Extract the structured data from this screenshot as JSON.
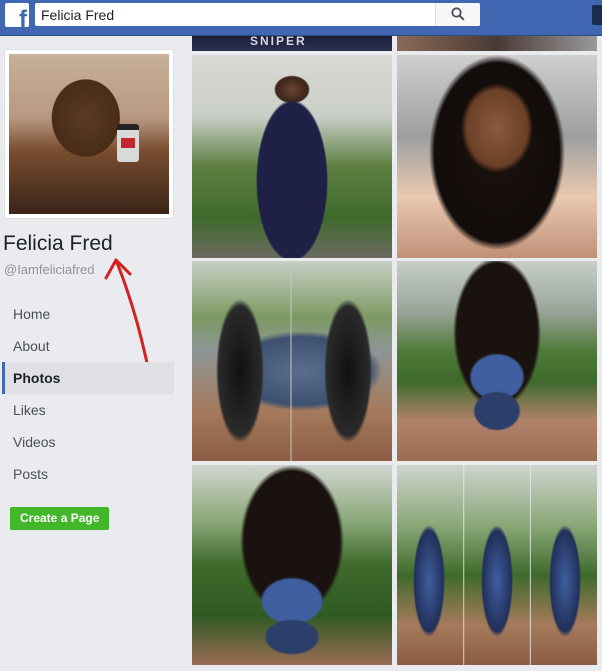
{
  "topbar": {
    "logo_letter": "f",
    "search_value": "Felicia Fred",
    "search_icon": "search-icon"
  },
  "profile": {
    "name": "Felicia Fred",
    "handle": "@Iamfeliciafred"
  },
  "nav": {
    "items": [
      {
        "label": "Home",
        "active": false
      },
      {
        "label": "About",
        "active": false
      },
      {
        "label": "Photos",
        "active": true
      },
      {
        "label": "Likes",
        "active": false
      },
      {
        "label": "Videos",
        "active": false
      },
      {
        "label": "Posts",
        "active": false
      }
    ]
  },
  "create_page_label": "Create a Page",
  "photos": {
    "top_shirt_text": "SNIPER"
  },
  "colors": {
    "brand_blue": "#4267b2",
    "create_green": "#42b72a",
    "annotation_red": "#d32020"
  }
}
